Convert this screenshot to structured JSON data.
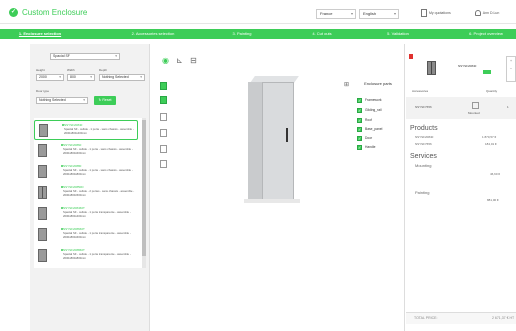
{
  "header": {
    "logo_glyph": "✓",
    "app_title": "Custom Enclosure",
    "country": "France",
    "language": "English",
    "my_quotations": "My quotations",
    "account": "Ann D.Lun"
  },
  "steps": [
    {
      "label": "1. Enclosure selection",
      "active": true
    },
    {
      "label": "2. Accessories selection",
      "active": false
    },
    {
      "label": "3. Painting",
      "active": false
    },
    {
      "label": "4. Cut outs",
      "active": false
    },
    {
      "label": "5. Validation",
      "active": false
    },
    {
      "label": "6. Project overview",
      "active": false
    }
  ],
  "filters": {
    "range": "Spacial SF",
    "height_label": "Height",
    "height_value": "2000",
    "width_label": "Width",
    "width_value": "800",
    "depth_label": "Depth",
    "depth_value": "Nothing Selected",
    "door_label": "Door type",
    "door_value": "Nothing Selected",
    "reset_label": "Reset"
  },
  "products": [
    {
      "code": "NSYSF20840",
      "desc": "Spacial SF - cellule - 1 porte - sans chassis - assemble - 2000x800x400mm",
      "double": false,
      "selected": true
    },
    {
      "code": "NSYSF20860",
      "desc": "Spacial SF - cellule - 1 porte - sans chassis - assemble - 2000x800x600mm",
      "double": false,
      "selected": false
    },
    {
      "code": "NSYSF20880",
      "desc": "Spacial SF - cellule - 1 porte - sans chassis - assemble - 2000x800x800mm",
      "double": false,
      "selected": false
    },
    {
      "code": "NSYSF20850D",
      "desc": "Spacial SF - cellule - 2 portes - sans chassis - assemble - 2000x800x500mm",
      "double": true,
      "selected": false
    },
    {
      "code": "NSYSF208460T",
      "desc": "Spacial SF - cellule - 1 porte transparente - assemble - 2000x800x400mm",
      "double": false,
      "selected": false
    },
    {
      "code": "NSYSF208660T",
      "desc": "Spacial SF - cellule - 1 porte transparente - assemble - 2000x800x600mm",
      "double": false,
      "selected": false
    },
    {
      "code": "NSYSF208860T",
      "desc": "Spacial SF - cellule - 1 porte transparente - assemble - 2000x800x800mm",
      "double": false,
      "selected": false
    }
  ],
  "viewer": {
    "parts_title": "Enclosure parts",
    "parts": [
      "Framework",
      "Gliding_rail",
      "Roof",
      "Base_panel",
      "Door",
      "Handle"
    ]
  },
  "summary": {
    "item_code": "NSYSF20840",
    "col_accessories": "Accessories",
    "col_quantity": "Quantity",
    "row_code": "NSYSF7656",
    "row_mount": "Mounted",
    "row_qty": "1",
    "products_title": "Products",
    "products": [
      {
        "code": "NSYSF20840",
        "price": "1 870,57 €"
      },
      {
        "code": "NSYSF7656",
        "price": "184,01 €"
      }
    ],
    "services_title": "Services",
    "mounting_label": "Mounting",
    "mounting_price": "46,60 €",
    "painting_label": "Painting",
    "painting_price": "881,00 €",
    "total_label": "TOTAL PRICE:",
    "total_value": "2 671,37 € HT"
  }
}
